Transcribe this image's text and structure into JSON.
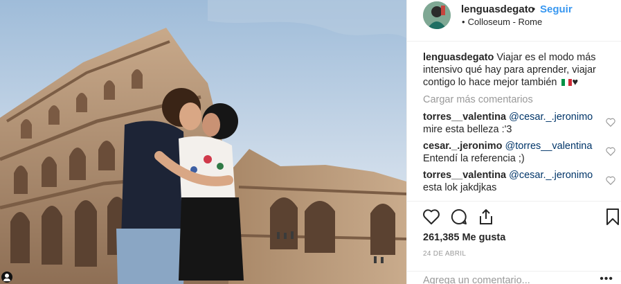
{
  "post": {
    "username": "lenguasdegato",
    "separator": "•",
    "follow_label": "Seguir",
    "location_bullet": "•",
    "location": "Colloseum - Rome",
    "caption": {
      "username": "lenguasdegato",
      "text": "Viajar es el modo más intensivo qué hay para aprender, viajar contigo lo hace mejor también",
      "heart": "♥",
      "flag_colors": [
        "#009246",
        "#ffffff",
        "#ce2b37"
      ]
    },
    "load_more_label": "Cargar más comentarios",
    "comments": [
      {
        "username": "torres__valentina",
        "mention": "@cesar._.jeronimo",
        "text": "mire esta belleza :'3"
      },
      {
        "username": "cesar._.jeronimo",
        "mention": "@torres__valentina",
        "text": "Entendí la referencia ;)"
      },
      {
        "username": "torres__valentina",
        "mention": "@cesar._.jeronimo",
        "text": "esta lok jakdjkas"
      }
    ],
    "actions": {
      "like_icon": "heart-outline-icon",
      "comment_icon": "speech-bubble-icon",
      "share_icon": "share-upload-icon",
      "save_icon": "bookmark-icon"
    },
    "likes_label": "261,385 Me gusta",
    "date": "24 DE ABRIL",
    "add_comment_placeholder": "Agrega un comentario...",
    "more_label": "•••"
  },
  "colors": {
    "link_blue": "#3897f0",
    "mention_blue": "#003569",
    "muted_gray": "#999999",
    "text": "#262626"
  }
}
